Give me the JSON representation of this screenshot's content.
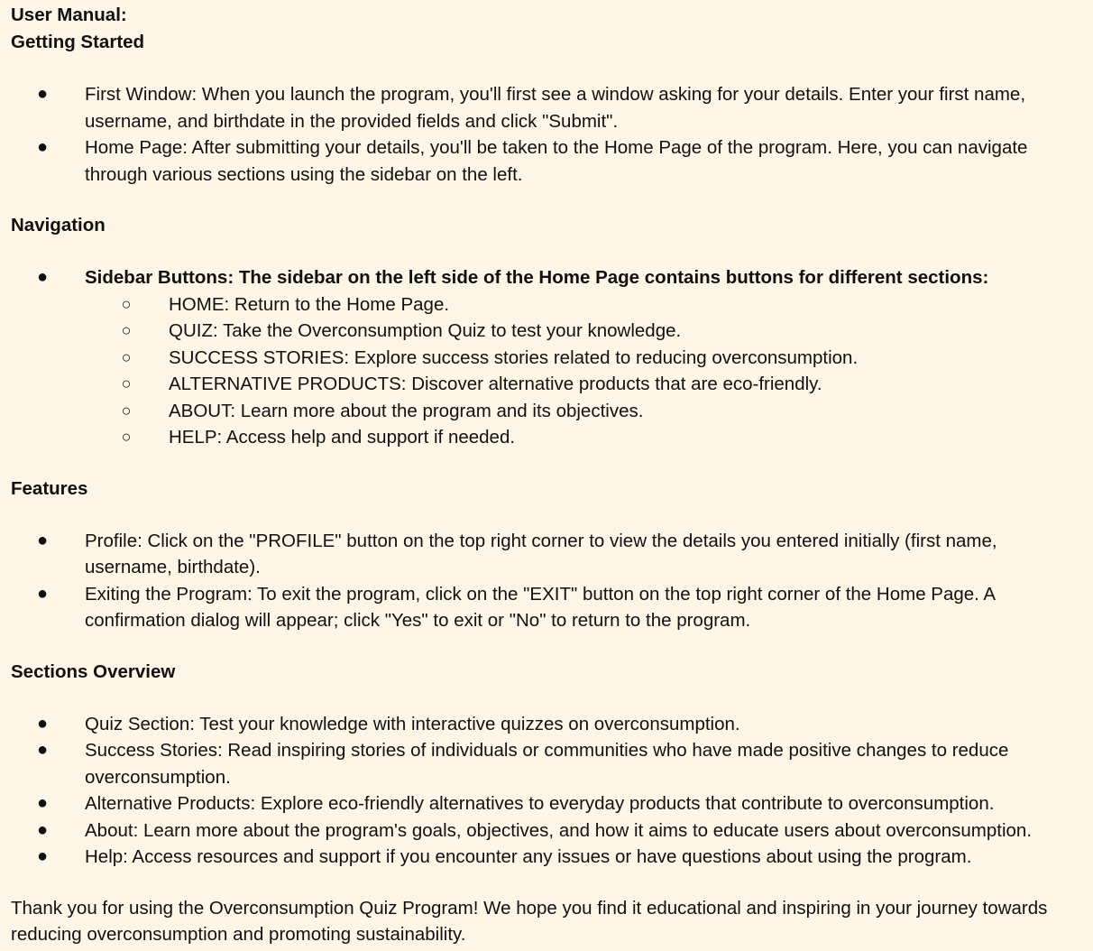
{
  "title": "User Manual:",
  "sections": {
    "getting_started": {
      "heading": "Getting Started",
      "items": [
        "First Window: When you launch the program, you'll first see a window asking for your details. Enter your first name, username, and birthdate in the provided fields and click \"Submit\".",
        "Home Page: After submitting your details, you'll be taken to the Home Page of the program. Here, you can navigate through various sections using the sidebar on the left."
      ]
    },
    "navigation": {
      "heading": "Navigation",
      "sidebar_intro": "Sidebar Buttons: The sidebar on the left side of the Home Page contains buttons for different sections:",
      "sub_items": [
        "HOME: Return to the Home Page.",
        "QUIZ: Take the Overconsumption Quiz to test your knowledge.",
        "SUCCESS STORIES: Explore success stories related to reducing overconsumption.",
        "ALTERNATIVE PRODUCTS: Discover alternative products that are eco-friendly.",
        "ABOUT: Learn more about the program and its objectives.",
        "HELP: Access help and support if needed."
      ]
    },
    "features": {
      "heading": "Features",
      "items": [
        "Profile: Click on the \"PROFILE\" button on the top right corner to view the details you entered initially (first name, username, birthdate).",
        "Exiting the Program: To exit the program, click on the \"EXIT\" button on the top right corner of the Home Page. A confirmation dialog will appear; click \"Yes\" to exit or \"No\" to return to the program."
      ]
    },
    "overview": {
      "heading": "Sections Overview",
      "items": [
        "Quiz Section: Test your knowledge with interactive quizzes on overconsumption.",
        "Success Stories: Read inspiring stories of individuals or communities who have made positive changes to reduce overconsumption.",
        "Alternative Products: Explore eco-friendly alternatives to everyday products that contribute to overconsumption.",
        "About: Learn more about the program's goals, objectives, and how it aims to educate users about overconsumption.",
        "Help: Access resources and support if you encounter any issues or have questions about using the program."
      ]
    }
  },
  "closing": "Thank you for using the Overconsumption Quiz Program! We hope you find it educational and inspiring in your journey towards reducing overconsumption and promoting sustainability.",
  "glyphs": {
    "bullet": "●",
    "sub_bullet": "○"
  }
}
